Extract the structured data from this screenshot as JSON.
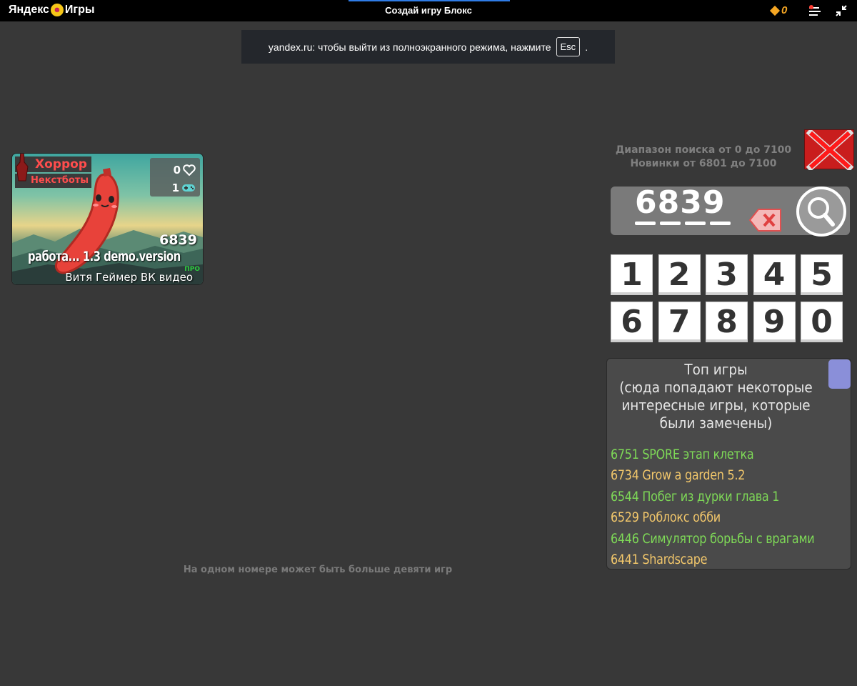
{
  "topbar": {
    "logo_left": "Яндекс",
    "logo_right": "Игры",
    "game_title": "Создай игру Блокс",
    "coins": "0",
    "load_progress": 1.0,
    "accent": "#f5a623"
  },
  "toast": {
    "message": "yandex.ru: чтобы выйти из полноэкранного режима, нажмите",
    "key": "Esc",
    "suffix": "."
  },
  "card": {
    "category": "Хоррор",
    "subcategory": "Некстботы",
    "likes": "0",
    "players": "1",
    "number": "6839",
    "name": "работа... 1.3 demo.version",
    "badge": "ПРО",
    "author": "Витя Геймер ВК видео"
  },
  "search": {
    "range_line1": "Диапазон поиска от 0 до 7100",
    "range_line2": "Новинки от 6801 до 7100",
    "value": "6839",
    "keys": [
      "1",
      "2",
      "3",
      "4",
      "5",
      "6",
      "7",
      "8",
      "9",
      "0"
    ]
  },
  "top_games": {
    "heading_line1": "Топ игры",
    "heading_line2": "(сюда попадают некоторые",
    "heading_line3": "интересные игры, которые",
    "heading_line4": "были замечены)",
    "items": [
      {
        "text": "6751 SPORE этап клетка",
        "color": "#7ed957"
      },
      {
        "text": "6734 Grow a garden 5.2",
        "color": "#f2c76b"
      },
      {
        "text": "6544 Побег из дурки глава 1",
        "color": "#7ed957"
      },
      {
        "text": "6529 Роблокс обби",
        "color": "#f2c76b"
      },
      {
        "text": "6446 Симулятор борьбы с врагами",
        "color": "#7ed957"
      },
      {
        "text": "6441 Shardscape",
        "color": "#f2c76b"
      }
    ]
  },
  "footnote": "На одном номере может быть больше девяти игр"
}
